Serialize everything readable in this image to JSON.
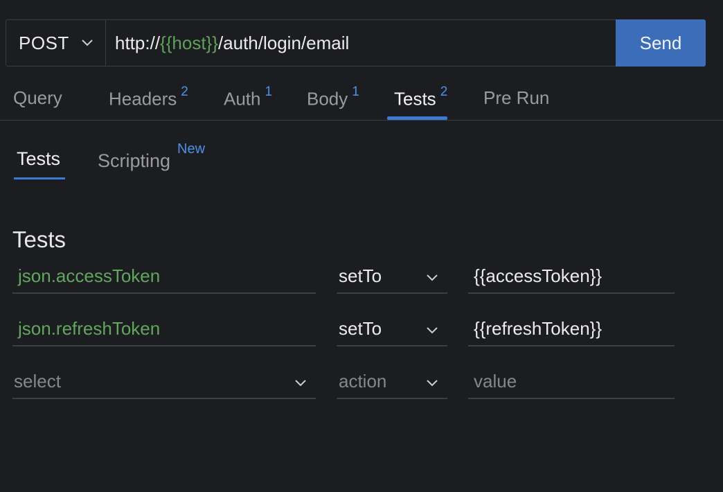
{
  "request": {
    "method": "POST",
    "url_prefix": "http://",
    "url_variable": "{{host}}",
    "url_suffix": "/auth/login/email",
    "send_label": "Send"
  },
  "tabs": [
    {
      "label": "Query",
      "badge": ""
    },
    {
      "label": "Headers",
      "badge": "2"
    },
    {
      "label": "Auth",
      "badge": "1"
    },
    {
      "label": "Body",
      "badge": "1"
    },
    {
      "label": "Tests",
      "badge": "2",
      "active": true
    },
    {
      "label": "Pre Run",
      "badge": ""
    }
  ],
  "subtabs": [
    {
      "label": "Tests",
      "active": true
    },
    {
      "label": "Scripting",
      "badge": "New"
    }
  ],
  "section_title": "Tests",
  "tests": [
    {
      "selector": "json.accessToken",
      "action": "setTo",
      "value": "{{accessToken}}"
    },
    {
      "selector": "json.refreshToken",
      "action": "setTo",
      "value": "{{refreshToken}}"
    }
  ],
  "new_test": {
    "selector_placeholder": "select",
    "action_placeholder": "action",
    "value_placeholder": "value"
  },
  "colors": {
    "background": "#1c1d21",
    "accent": "#3c6db8",
    "variable_green": "#5fa05a",
    "badge_blue": "#4f8fe8"
  }
}
